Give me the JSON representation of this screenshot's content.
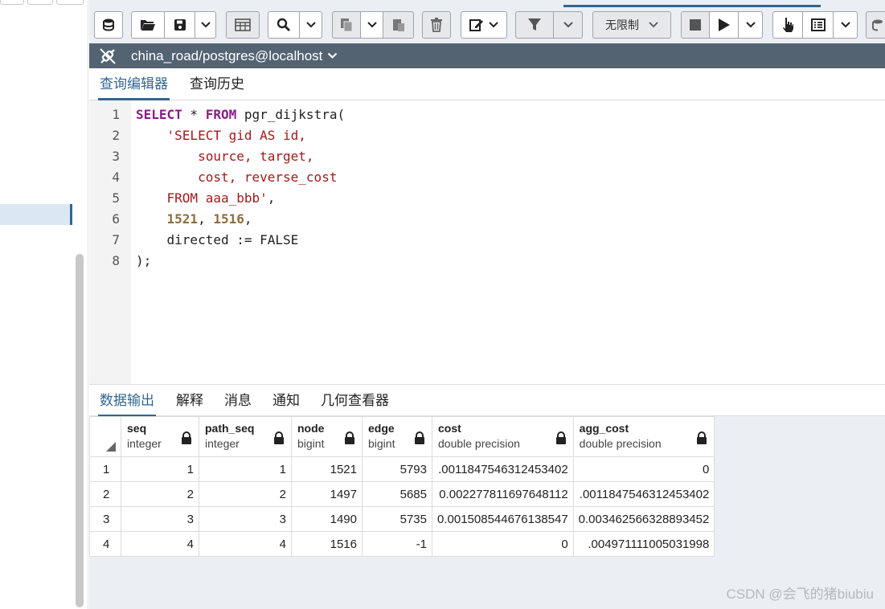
{
  "toolbar": {
    "limit_select": {
      "value": "无限制"
    }
  },
  "connection": {
    "label": "china_road/postgres@localhost"
  },
  "query_tabs": [
    {
      "label": "查询编辑器",
      "active": true
    },
    {
      "label": "查询历史",
      "active": false
    }
  ],
  "editor": {
    "line_numbers": [
      "1",
      "2",
      "3",
      "4",
      "5",
      "6",
      "7",
      "8"
    ],
    "lines": [
      [
        {
          "t": "SELECT",
          "c": "kw"
        },
        {
          "t": " * ",
          "c": ""
        },
        {
          "t": "FROM",
          "c": "kw"
        },
        {
          "t": " pgr_dijkstra(",
          "c": ""
        }
      ],
      [
        {
          "t": "    ",
          "c": ""
        },
        {
          "t": "'SELECT gid AS id,",
          "c": "str"
        }
      ],
      [
        {
          "t": "        ",
          "c": ""
        },
        {
          "t": "source, target,",
          "c": "str"
        }
      ],
      [
        {
          "t": "        ",
          "c": ""
        },
        {
          "t": "cost, reverse_cost",
          "c": "str"
        }
      ],
      [
        {
          "t": "    ",
          "c": ""
        },
        {
          "t": "FROM aaa_bbb'",
          "c": "str"
        },
        {
          "t": ",",
          "c": ""
        }
      ],
      [
        {
          "t": "    ",
          "c": ""
        },
        {
          "t": "1521",
          "c": "num"
        },
        {
          "t": ", ",
          "c": ""
        },
        {
          "t": "1516",
          "c": "num"
        },
        {
          "t": ",",
          "c": ""
        }
      ],
      [
        {
          "t": "    directed := FALSE",
          "c": ""
        }
      ],
      [
        {
          "t": ");",
          "c": ""
        }
      ]
    ]
  },
  "result_tabs": [
    {
      "label": "数据输出",
      "active": true
    },
    {
      "label": "解释",
      "active": false
    },
    {
      "label": "消息",
      "active": false
    },
    {
      "label": "通知",
      "active": false
    },
    {
      "label": "几何查看器",
      "active": false
    }
  ],
  "grid": {
    "columns": [
      {
        "name": "seq",
        "type": "integer"
      },
      {
        "name": "path_seq",
        "type": "integer"
      },
      {
        "name": "node",
        "type": "bigint"
      },
      {
        "name": "edge",
        "type": "bigint"
      },
      {
        "name": "cost",
        "type": "double precision"
      },
      {
        "name": "agg_cost",
        "type": "double precision"
      }
    ],
    "rows": [
      {
        "num": "1",
        "cells": [
          "1",
          "1",
          "1521",
          "5793",
          ".0011847546312453402",
          "0"
        ]
      },
      {
        "num": "2",
        "cells": [
          "2",
          "2",
          "1497",
          "5685",
          "0.002277811697648112",
          ".0011847546312453402"
        ]
      },
      {
        "num": "3",
        "cells": [
          "3",
          "3",
          "1490",
          "5735",
          "0.001508544676138547",
          "0.003462566328893452"
        ]
      },
      {
        "num": "4",
        "cells": [
          "4",
          "4",
          "1516",
          "-1",
          "0",
          ".004971111005031998"
        ]
      }
    ]
  },
  "watermark": "CSDN @会飞的猪biubiu"
}
